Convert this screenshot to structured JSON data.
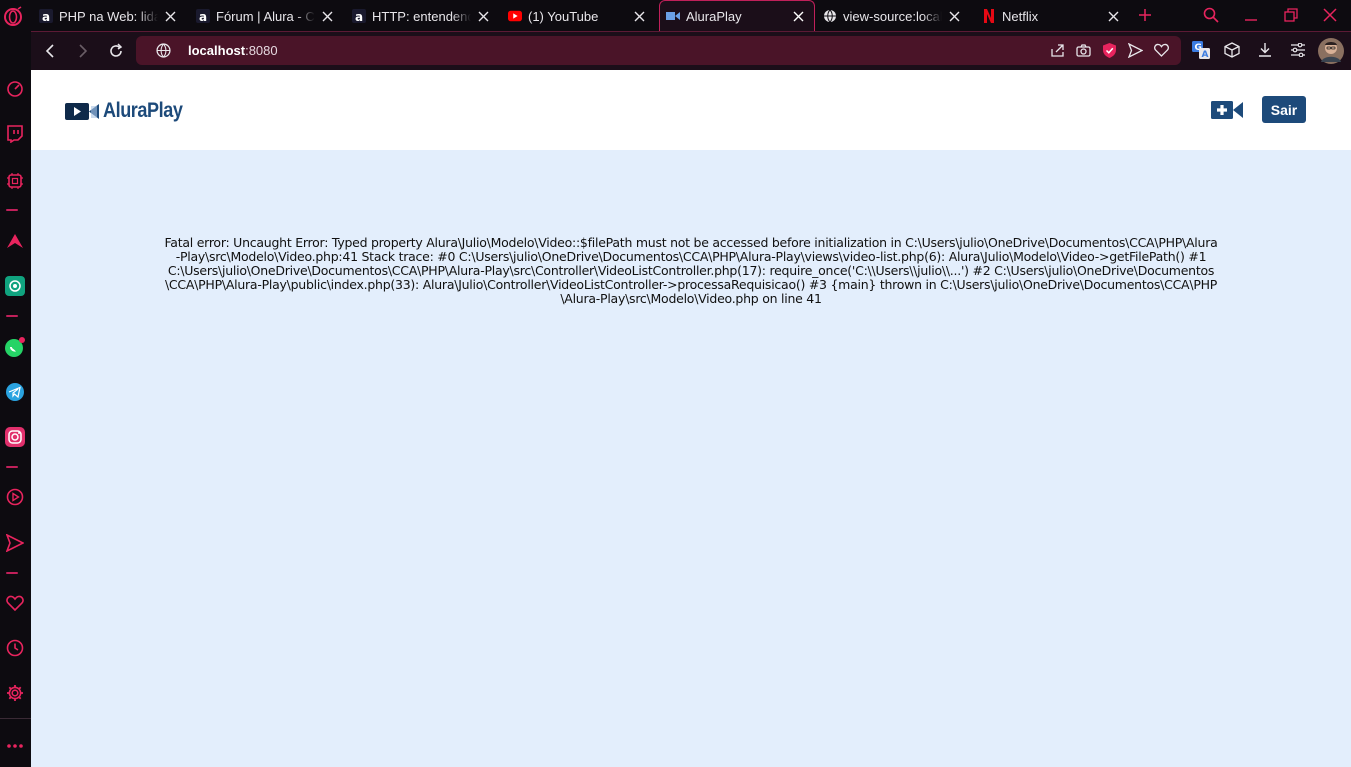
{
  "browser": {
    "tabs": [
      {
        "title": "PHP na Web: lidando",
        "favicon": "alura-icon",
        "active": false
      },
      {
        "title": "Fórum | Alura - Cur",
        "favicon": "alura-icon",
        "active": false
      },
      {
        "title": "HTTP: entendendo",
        "favicon": "alura-icon",
        "active": false
      },
      {
        "title": "(1) YouTube",
        "favicon": "youtube-icon",
        "active": false
      },
      {
        "title": "AluraPlay",
        "favicon": "aluraplay-icon",
        "active": true
      },
      {
        "title": "view-source:localho",
        "favicon": "globe-icon",
        "active": false
      },
      {
        "title": "Netflix",
        "favicon": "netflix-icon",
        "active": false
      }
    ],
    "url": {
      "host": "localhost",
      "port": ":8080"
    },
    "accent": "#c0205a"
  },
  "site": {
    "logo_text": "AluraPlay",
    "logout_label": "Sair",
    "brand_color": "#1d4a7a"
  },
  "error": {
    "message": "Fatal error: Uncaught Error: Typed property Alura\\Julio\\Modelo\\Video::$filePath must not be accessed before initialization in C:\\Users\\julio\\OneDrive\\Documentos\\CCA\\PHP\\Alura-Play\\src\\Modelo\\Video.php:41 Stack trace: #0 C:\\Users\\julio\\OneDrive\\Documentos\\CCA\\PHP\\Alura-Play\\views\\video-list.php(6): Alura\\Julio\\Modelo\\Video->getFilePath() #1 C:\\Users\\julio\\OneDrive\\Documentos\\CCA\\PHP\\Alura-Play\\src\\Controller\\VideoListController.php(17): require_once('C:\\\\Users\\\\julio\\\\...') #2 C:\\Users\\julio\\OneDrive\\Documentos\\CCA\\PHP\\Alura-Play\\public\\index.php(33): Alura\\Julio\\Controller\\VideoListController->processaRequisicao() #3 {main} thrown in C:\\Users\\julio\\OneDrive\\Documentos\\CCA\\PHP\\Alura-Play\\src\\Modelo\\Video.php on line 41"
  }
}
